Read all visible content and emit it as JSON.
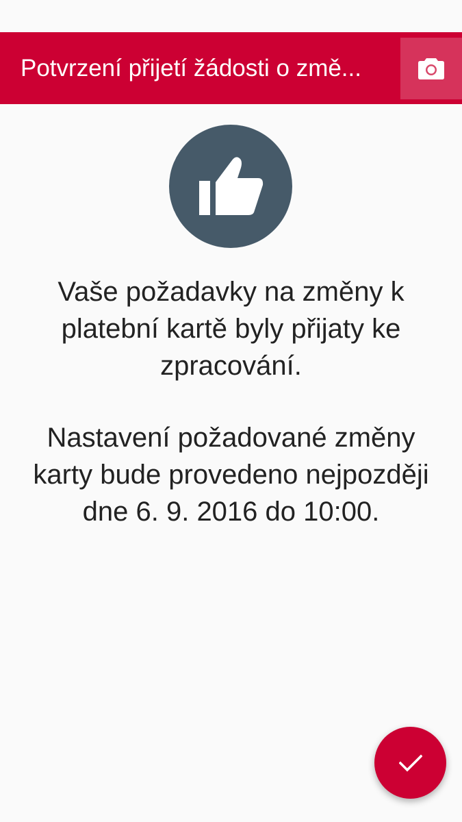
{
  "toolbar": {
    "title": "Potvrzení přijetí žádosti o změ...",
    "camera_icon": "camera-icon",
    "background_color": "#cc0033"
  },
  "hero": {
    "icon": "thumbs-up-icon",
    "circle_color": "#465a69"
  },
  "messages": {
    "confirmation": "Vaše požadavky na změny k platební kartě byly přijaty ke zpracování.",
    "schedule": "Nastavení požadované změny karty bude provedeno nejpozději dne 6. 9. 2016 do 10:00."
  },
  "fab": {
    "icon": "checkmark-icon",
    "color": "#cc0033"
  }
}
